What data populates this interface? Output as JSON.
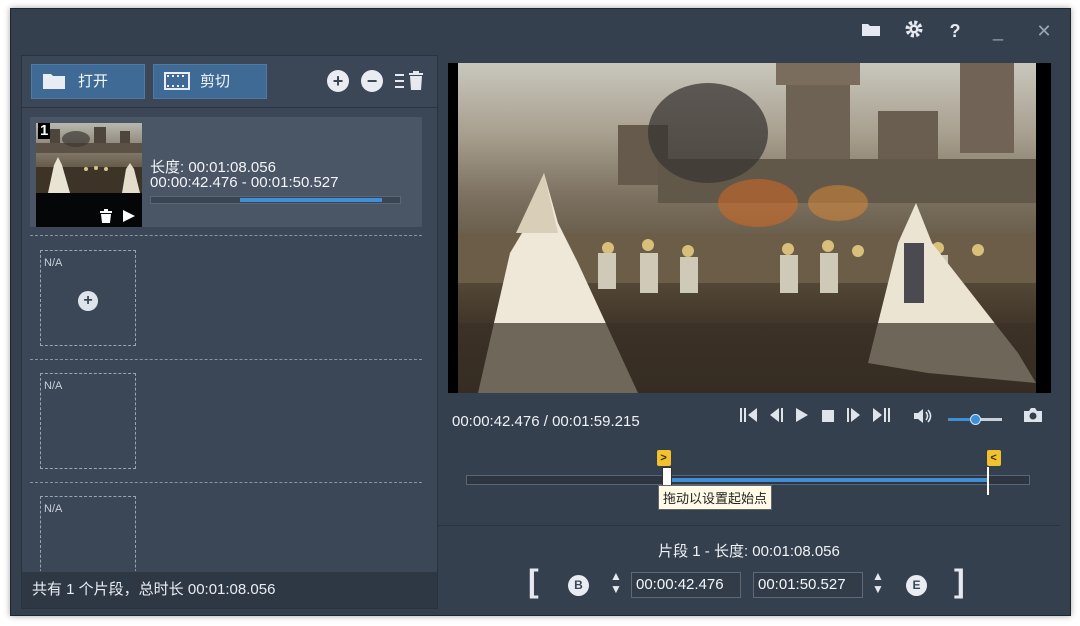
{
  "title_icons": [
    "folder-icon",
    "gear-icon",
    "help-icon",
    "minimize-icon",
    "close-icon"
  ],
  "title": {
    "help": "?",
    "minimize": "_",
    "close": "✕"
  },
  "toolbar": {
    "open_label": "打开",
    "cut_label": "剪切"
  },
  "clips": [
    {
      "index": "1",
      "duration_label": "长度: 00:01:08.056",
      "range_label": "00:00:42.476  -  00:01:50.527",
      "range_start_fraction": 0.357,
      "range_end_fraction": 0.928
    }
  ],
  "empty_slot_label": "N/A",
  "status": {
    "summary": "共有 1 个片段，总时长 00:01:08.056"
  },
  "player": {
    "time_display": "00:00:42.476 / 00:01:59.215",
    "volume_level": 0.5,
    "start_flag": ">",
    "end_flag": "<",
    "tooltip": "拖动以设置起始点",
    "selection_start_fraction": 0.357,
    "selection_end_fraction": 0.928
  },
  "segment": {
    "title": "片段 1 - 长度: 00:01:08.056",
    "begin_badge": "B",
    "end_badge": "E",
    "start_time": "00:00:42.476",
    "end_time": "00:01:50.527",
    "open_bracket": "[",
    "close_bracket": "]"
  },
  "colors": {
    "accent": "#3f8fd6",
    "panel": "#3b4757",
    "button": "#3f6a96",
    "marker": "#f2c12e"
  }
}
